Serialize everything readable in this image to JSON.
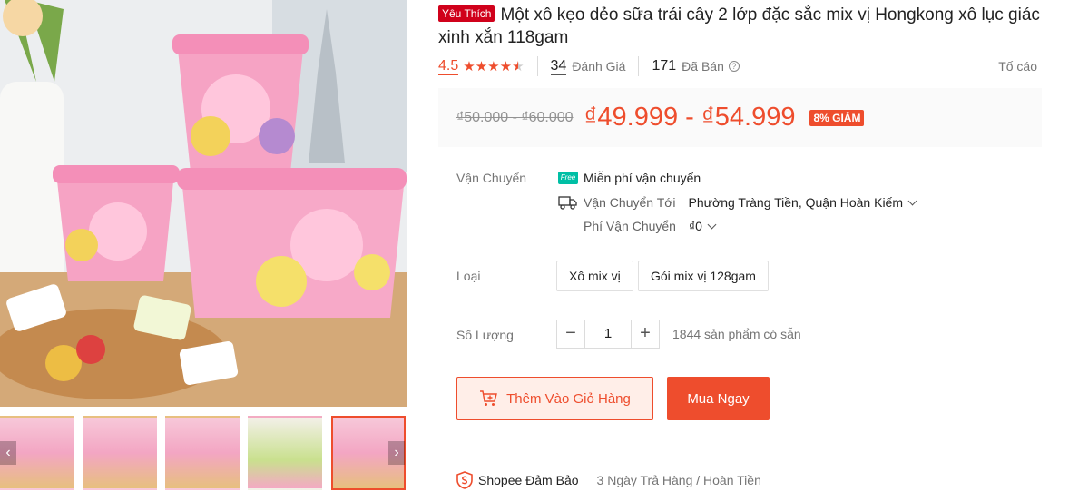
{
  "product": {
    "badge": "Yêu Thích",
    "title": "Một xô kẹo dẻo sữa trái cây 2 lớp đặc sắc mix vị Hongkong xô lục giác xinh xắn 118gam"
  },
  "rating": {
    "score": "4.5",
    "stars": 4.5,
    "review_count": "34",
    "review_label": "Đánh Giá",
    "sold_count": "171",
    "sold_label": "Đã Bán",
    "report_label": "Tố cáo"
  },
  "price": {
    "original": "₫50.000 - ₫60.000",
    "current": "₫49.999 - ₫54.999",
    "discount": "8% GIẢM"
  },
  "shipping": {
    "label": "Vận Chuyển",
    "free_badge": "Free",
    "free_text": "Miễn phí vận chuyển",
    "to_label": "Vận Chuyển Tới",
    "to_value": "Phường Tràng Tiền, Quận Hoàn Kiếm",
    "fee_label": "Phí Vận Chuyển",
    "fee_value": "₫0"
  },
  "variants": {
    "label": "Loại",
    "options": [
      "Xô mix vị",
      "Gói mix vị 128gam"
    ]
  },
  "quantity": {
    "label": "Số Lượng",
    "decrement": "−",
    "value": "1",
    "increment": "+",
    "stock": "1844 sản phẩm có sẵn"
  },
  "actions": {
    "add_to_cart": "Thêm Vào Giỏ Hàng",
    "buy_now": "Mua Ngay"
  },
  "guarantee": {
    "title": "Shopee Đảm Bảo",
    "text": "3 Ngày Trả Hàng / Hoàn Tiền"
  },
  "gallery": {
    "prev_arrow": "‹",
    "next_arrow": "›"
  },
  "colors": {
    "accent": "#ee4d2d",
    "badge": "#d0011b",
    "free_shipping": "#00bfa5"
  }
}
